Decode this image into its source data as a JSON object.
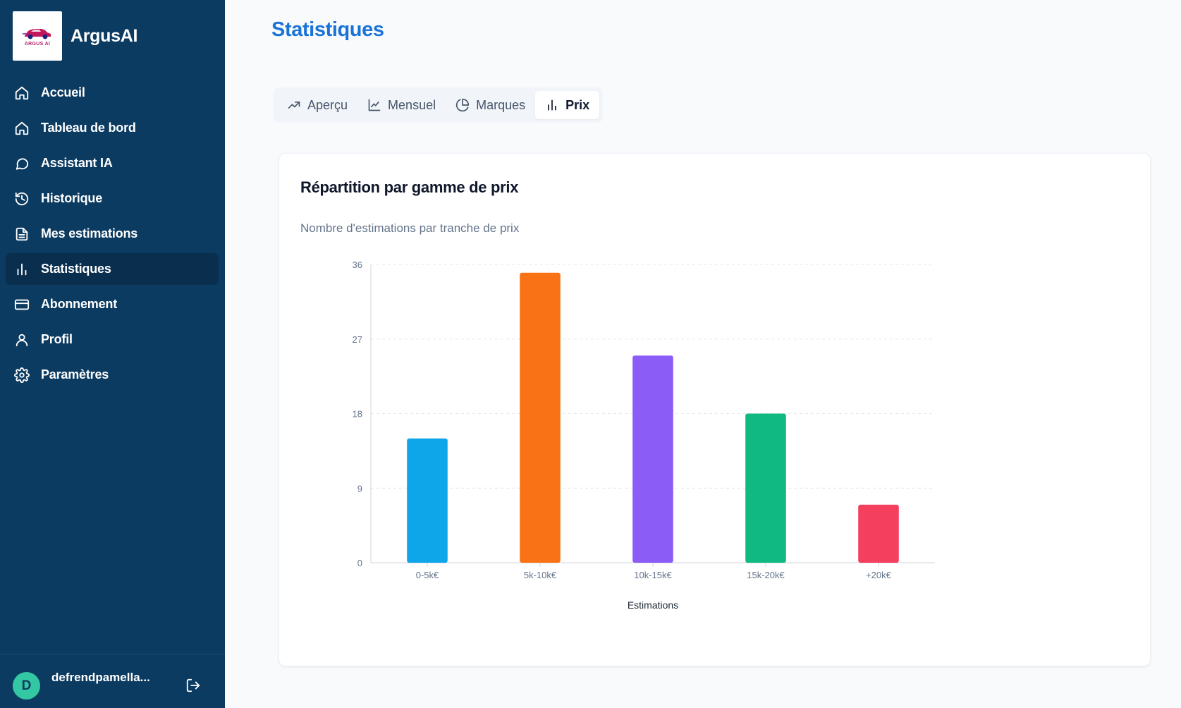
{
  "app": {
    "name": "ArgusAI",
    "logo_text": "ARGUS AI"
  },
  "sidebar": {
    "items": [
      {
        "label": "Accueil",
        "icon": "home-icon",
        "active": false
      },
      {
        "label": "Tableau de bord",
        "icon": "home-icon",
        "active": false
      },
      {
        "label": "Assistant IA",
        "icon": "chat-bubble-icon",
        "active": false
      },
      {
        "label": "Historique",
        "icon": "history-icon",
        "active": false
      },
      {
        "label": "Mes estimations",
        "icon": "document-icon",
        "active": false
      },
      {
        "label": "Statistiques",
        "icon": "bar-chart-icon",
        "active": true
      },
      {
        "label": "Abonnement",
        "icon": "credit-card-icon",
        "active": false
      },
      {
        "label": "Profil",
        "icon": "user-icon",
        "active": false
      },
      {
        "label": "Paramètres",
        "icon": "gear-icon",
        "active": false
      }
    ],
    "user": {
      "initial": "D",
      "name": "defrendpamella..."
    }
  },
  "page": {
    "title": "Statistiques"
  },
  "tabs": [
    {
      "label": "Aperçu",
      "icon": "trend-up-icon",
      "active": false
    },
    {
      "label": "Mensuel",
      "icon": "line-chart-icon",
      "active": false
    },
    {
      "label": "Marques",
      "icon": "pie-chart-icon",
      "active": false
    },
    {
      "label": "Prix",
      "icon": "bar-chart-icon",
      "active": true
    }
  ],
  "card": {
    "title": "Répartition par gamme de prix",
    "subtitle": "Nombre d'estimations par tranche de prix"
  },
  "chart_data": {
    "type": "bar",
    "categories": [
      "0-5k€",
      "5k-10k€",
      "10k-15k€",
      "15k-20k€",
      "+20k€"
    ],
    "values": [
      15,
      35,
      25,
      18,
      7
    ],
    "colors": [
      "#0ea5e9",
      "#f97316",
      "#8b5cf6",
      "#10b981",
      "#f43f5e"
    ],
    "xlabel": "Estimations",
    "ylabel": "",
    "ylim": [
      0,
      36
    ],
    "yticks": [
      0,
      9,
      18,
      27,
      36
    ],
    "grid": true
  }
}
